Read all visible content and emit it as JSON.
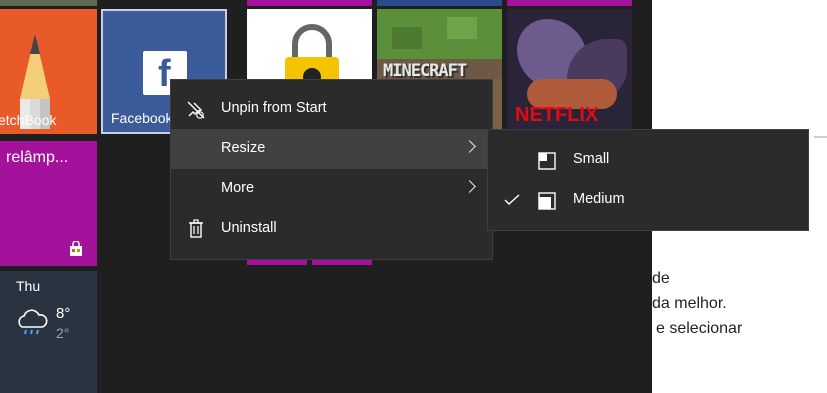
{
  "tiles": {
    "sketchbook": {
      "label": "etchBook"
    },
    "facebook": {
      "label": "Facebook"
    },
    "store_tile": {
      "title": "relâmp..."
    },
    "netflix": {
      "logo_text": "NETFLIX"
    },
    "minecraft": {
      "logo_text": "MINECRAFT"
    },
    "weather": {
      "day": "Thu",
      "high": "8°",
      "low": "2°"
    }
  },
  "context_menu": {
    "items": [
      {
        "label": "Unpin from Start",
        "icon": "unpin-icon"
      },
      {
        "label": "Resize",
        "icon": "none"
      },
      {
        "label": "More",
        "icon": "none"
      },
      {
        "label": "Uninstall",
        "icon": "trash-icon"
      }
    ]
  },
  "resize_submenu": {
    "items": [
      {
        "label": "Small",
        "checked": false,
        "icon": "size-small-icon"
      },
      {
        "label": "Medium",
        "checked": true,
        "icon": "size-medium-icon"
      }
    ]
  },
  "background_doc": {
    "lines": [
      "de",
      "da melhor.",
      "e selecionar"
    ]
  },
  "colors": {
    "accent_blue": "#3b5b9b",
    "magenta": "#a4129c",
    "sketchbook_orange": "#e85a2a",
    "menu_bg": "#2b2b2b",
    "menu_highlight": "#414141",
    "netflix_red": "#e50914"
  }
}
